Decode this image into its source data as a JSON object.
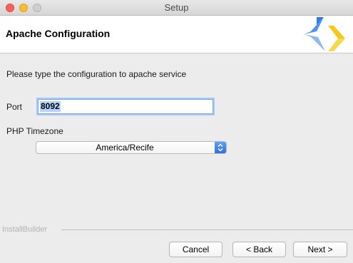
{
  "window": {
    "title": "Setup"
  },
  "header": {
    "title": "Apache Configuration"
  },
  "main": {
    "instruction": "Please type the configuration to apache service",
    "port": {
      "label": "Port",
      "value": "8092"
    },
    "timezone": {
      "label": "PHP Timezone",
      "selected": "America/Recife"
    }
  },
  "footer": {
    "brand": "InstallBuilder",
    "cancel_label": "Cancel",
    "back_label": "< Back",
    "next_label": "Next >"
  },
  "icons": {
    "logo": "installbuilder-logo-icon",
    "select_arrow": "chevron-updown-icon"
  },
  "colors": {
    "focus_ring": "#a9c8f5",
    "select_accent": "#3b7ff0",
    "logo_blue": "#2f7de0",
    "logo_yellow": "#f7c81c",
    "close": "#fc5f57",
    "minimize": "#fdbc2e"
  }
}
